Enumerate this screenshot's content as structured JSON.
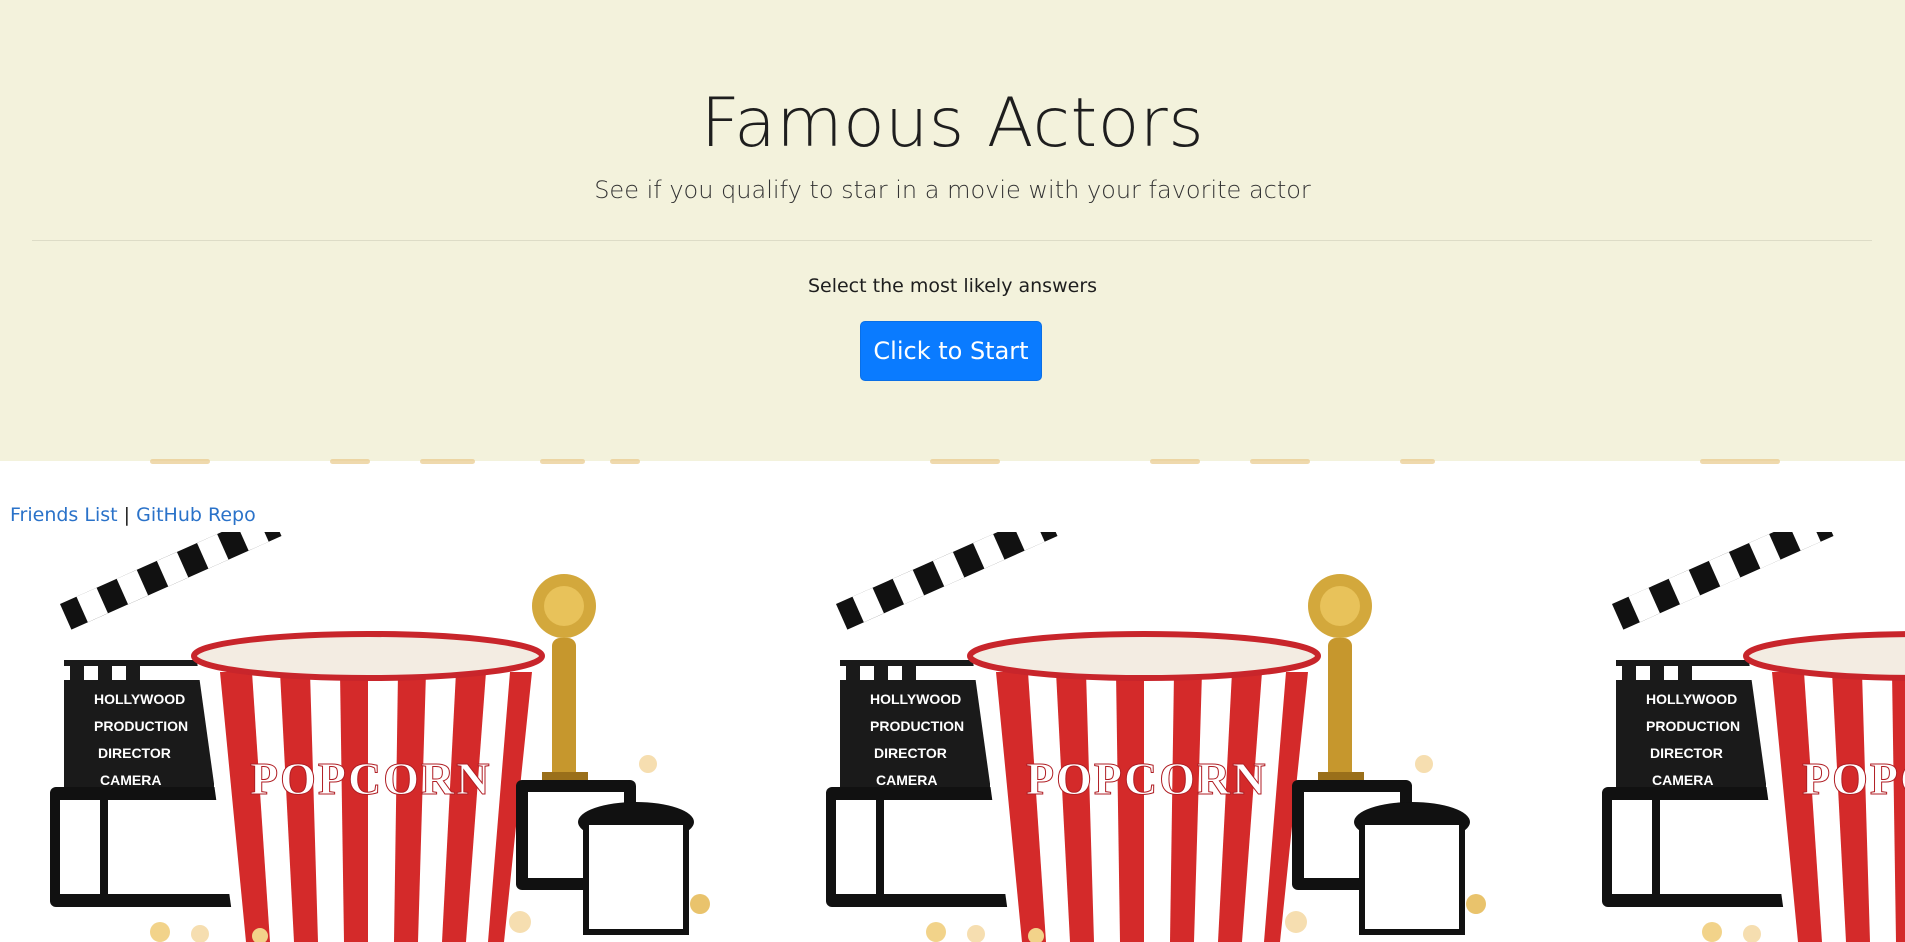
{
  "header": {
    "title": "Famous Actors",
    "subtitle": "See if you qualify to star in a movie with your favorite actor",
    "instruction": "Select the most likely answers",
    "start_button": "Click to Start"
  },
  "links": {
    "friends_list": "Friends List",
    "separator": "|",
    "github_repo": "GitHub Repo"
  },
  "background_image": {
    "clapper_lines": [
      "HOLLYWOOD",
      "PRODUCTION",
      "DIRECTOR",
      "CAMERA"
    ],
    "bucket_text": "POPCORN",
    "icon": "popcorn-background-icon"
  },
  "colors": {
    "jumbotron_bg": "#f3f2dc",
    "button_bg": "#0a7bff",
    "link": "#2a72c9",
    "popcorn_red": "#d42a2a"
  }
}
